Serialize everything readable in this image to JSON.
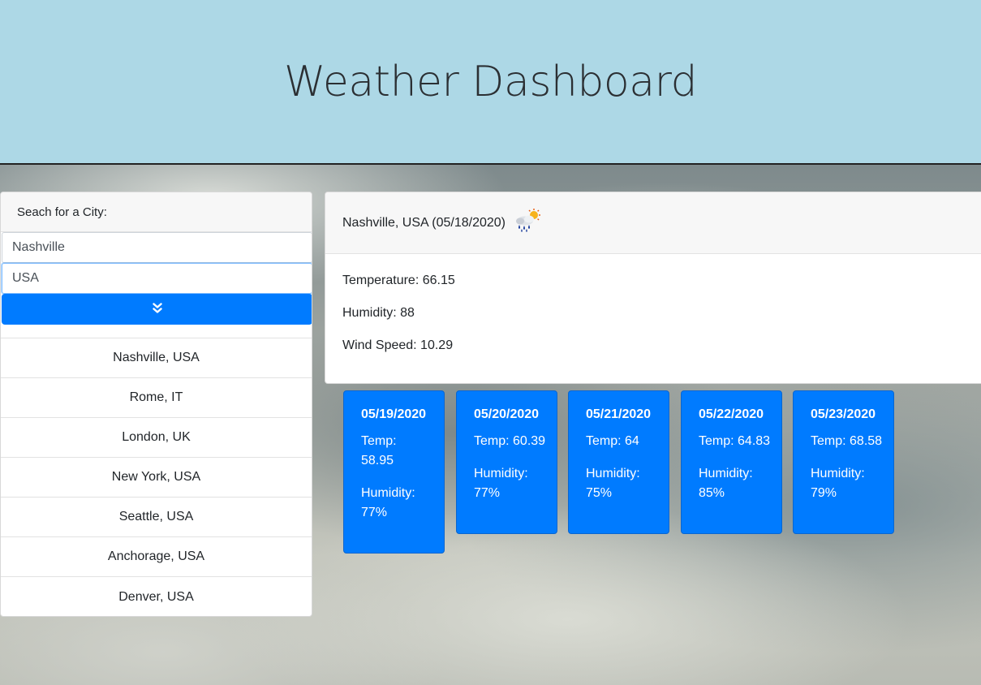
{
  "header": {
    "title": "Weather Dashboard"
  },
  "search": {
    "heading": "Seach for a City:",
    "city_value": "Nashville",
    "country_value": "USA",
    "button_icon": "chevron-double-down-icon"
  },
  "history": [
    {
      "label": "Nashville, USA"
    },
    {
      "label": "Rome, IT"
    },
    {
      "label": "London, UK"
    },
    {
      "label": "New York, USA"
    },
    {
      "label": "Seattle, USA"
    },
    {
      "label": "Anchorage, USA"
    },
    {
      "label": "Denver, USA"
    }
  ],
  "current": {
    "title": "Nashville, USA (05/18/2020)",
    "icon": "rain-sun-icon",
    "temperature": "Temperature: 66.15",
    "humidity": "Humidity: 88",
    "wind": "Wind Speed: 10.29"
  },
  "forecast": [
    {
      "date": "05/19/2020",
      "temp_label": "Temp:",
      "temp_value": "58.95",
      "hum_label": "Humidity:",
      "hum_value": "77%"
    },
    {
      "date": "05/20/2020",
      "temp_label": "Temp:",
      "temp_value": "60.39",
      "hum_label": "Humidity:",
      "hum_value": "77%"
    },
    {
      "date": "05/21/2020",
      "temp_label": "Temp:",
      "temp_value": "64",
      "hum_label": "Humidity:",
      "hum_value": "75%"
    },
    {
      "date": "05/22/2020",
      "temp_label": "Temp:",
      "temp_value": "64.83",
      "hum_label": "Humidity:",
      "hum_value": "85%"
    },
    {
      "date": "05/23/2020",
      "temp_label": "Temp:",
      "temp_value": "68.58",
      "hum_label": "Humidity:",
      "hum_value": "79%"
    }
  ],
  "colors": {
    "header_bg": "#add8e6",
    "accent": "#007bff"
  }
}
